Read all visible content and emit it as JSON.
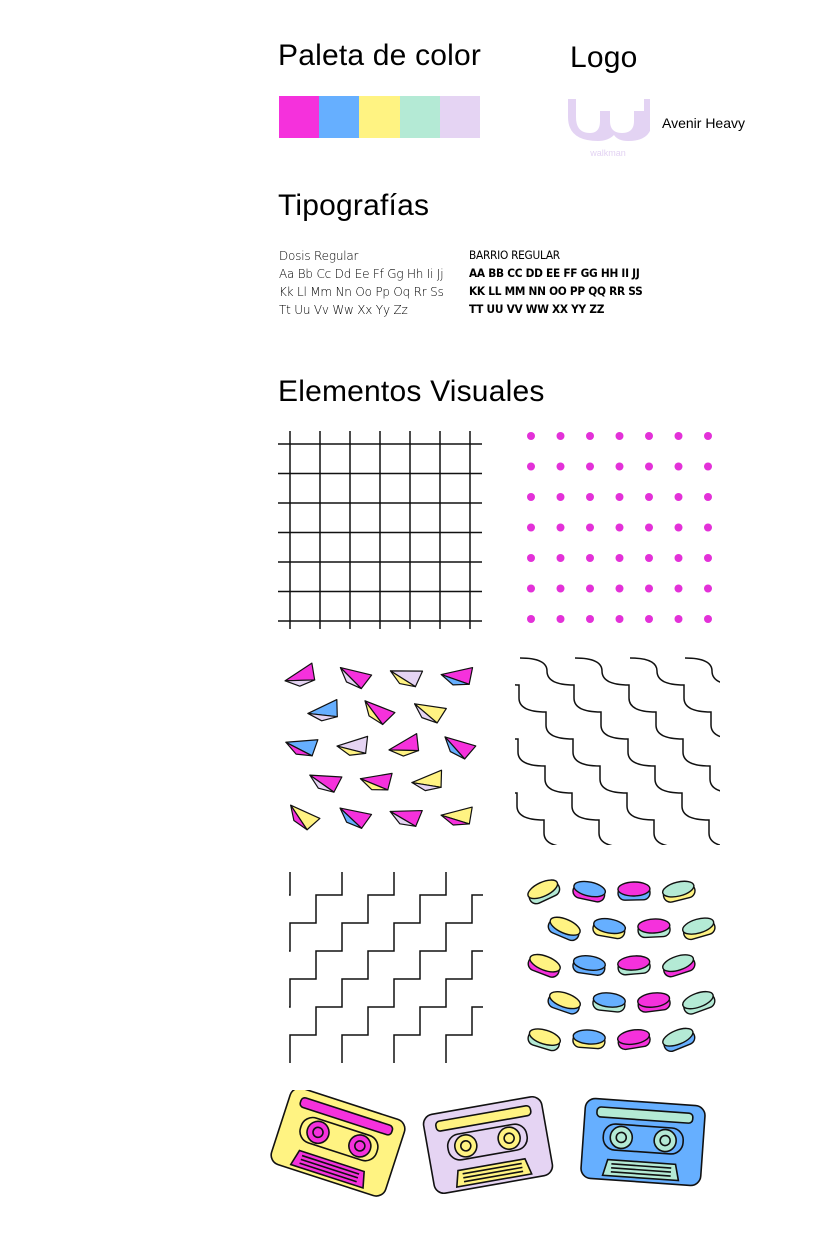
{
  "sections": {
    "palette_title": "Paleta de color",
    "logo_title": "Logo",
    "typography_title": "Tipografías",
    "visual_title": "Elementos Visuales"
  },
  "palette": {
    "colors": [
      "#f531dc",
      "#66afff",
      "#fff382",
      "#b4ead5",
      "#e5d4f3"
    ]
  },
  "logo": {
    "wordmark": "walkman",
    "font_name": "Avenir Heavy",
    "color": "#e3d3f3"
  },
  "typography": {
    "font_a": {
      "name": "Dosis Regular",
      "lines": [
        "Aa Bb Cc Dd Ee Ff Gg Hh Ii Jj",
        "Kk Ll Mm Nn Oo Pp Oq Rr Ss",
        "Tt Uu Vv Ww Xx Yy Zz"
      ]
    },
    "font_b": {
      "name": "Barrio Regular",
      "lines": [
        "AA BB CC DD EE FF GG HH II JJ",
        "KK LL MM NN OO PP QQ RR SS",
        "TT UU VV WW XX YY ZZ"
      ]
    }
  },
  "visual_elements": {
    "patterns": [
      "grid-pattern",
      "dot-pattern",
      "triangle-pattern",
      "wave-pattern",
      "stair-pattern",
      "pill-pattern"
    ],
    "cassettes": [
      "cassette-yellow",
      "cassette-lavender",
      "cassette-blue"
    ]
  }
}
